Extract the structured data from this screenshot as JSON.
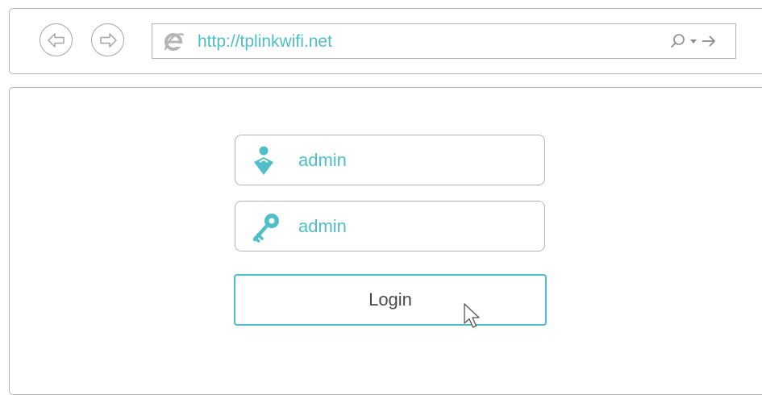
{
  "browser": {
    "url": "http://tplinkwifi.net",
    "icons": {
      "back": "back-arrow-icon",
      "forward": "forward-arrow-icon",
      "browser_logo": "ie-logo-icon",
      "search": "search-icon",
      "dropdown": "dropdown-caret-icon",
      "go": "go-arrow-icon"
    }
  },
  "login": {
    "username_value": "admin",
    "password_value": "admin",
    "login_label": "Login",
    "icons": {
      "username": "user-icon",
      "password": "key-icon",
      "pointer": "mouse-cursor-icon"
    }
  },
  "colors": {
    "accent": "#4ebfc6",
    "border": "#b4b4b4",
    "text": "#4a4a4a"
  }
}
